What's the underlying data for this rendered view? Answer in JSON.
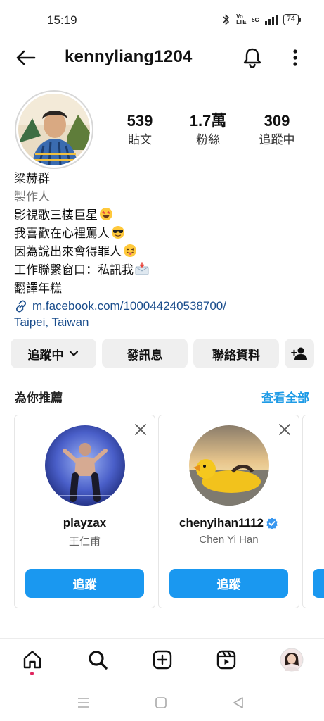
{
  "status_bar": {
    "time": "15:19",
    "signal_text": "Vo LTE",
    "network": "5G",
    "battery": "74"
  },
  "header": {
    "username": "kennyliang1204"
  },
  "stats": [
    {
      "value": "539",
      "label": "貼文"
    },
    {
      "value": "1.7萬",
      "label": "粉絲"
    },
    {
      "value": "309",
      "label": "追蹤中"
    }
  ],
  "bio": {
    "name": "梁赫群",
    "category": "製作人",
    "line1": "影視歌三棲巨星",
    "line2": "我喜歡在心裡罵人",
    "line3": "因為說出來會得罪人",
    "line4": "工作聯繫窗口：私訊我",
    "line5": "翻譯年糕",
    "link": "m.facebook.com/100044240538700/",
    "location": "Taipei, Taiwan"
  },
  "actions": {
    "following": "追蹤中",
    "message": "發訊息",
    "contact": "聯絡資料"
  },
  "suggestions": {
    "title": "為你推薦",
    "see_all": "查看全部",
    "cards": [
      {
        "username": "playzax",
        "subtitle": "王仁甫",
        "follow": "追蹤"
      },
      {
        "username": "chenyihan1112",
        "subtitle": "Chen Yi Han",
        "follow": "追蹤"
      }
    ]
  },
  "colors": {
    "accent": "#1a98f0",
    "link": "#1a4d8c",
    "button_bg": "#efefef"
  }
}
